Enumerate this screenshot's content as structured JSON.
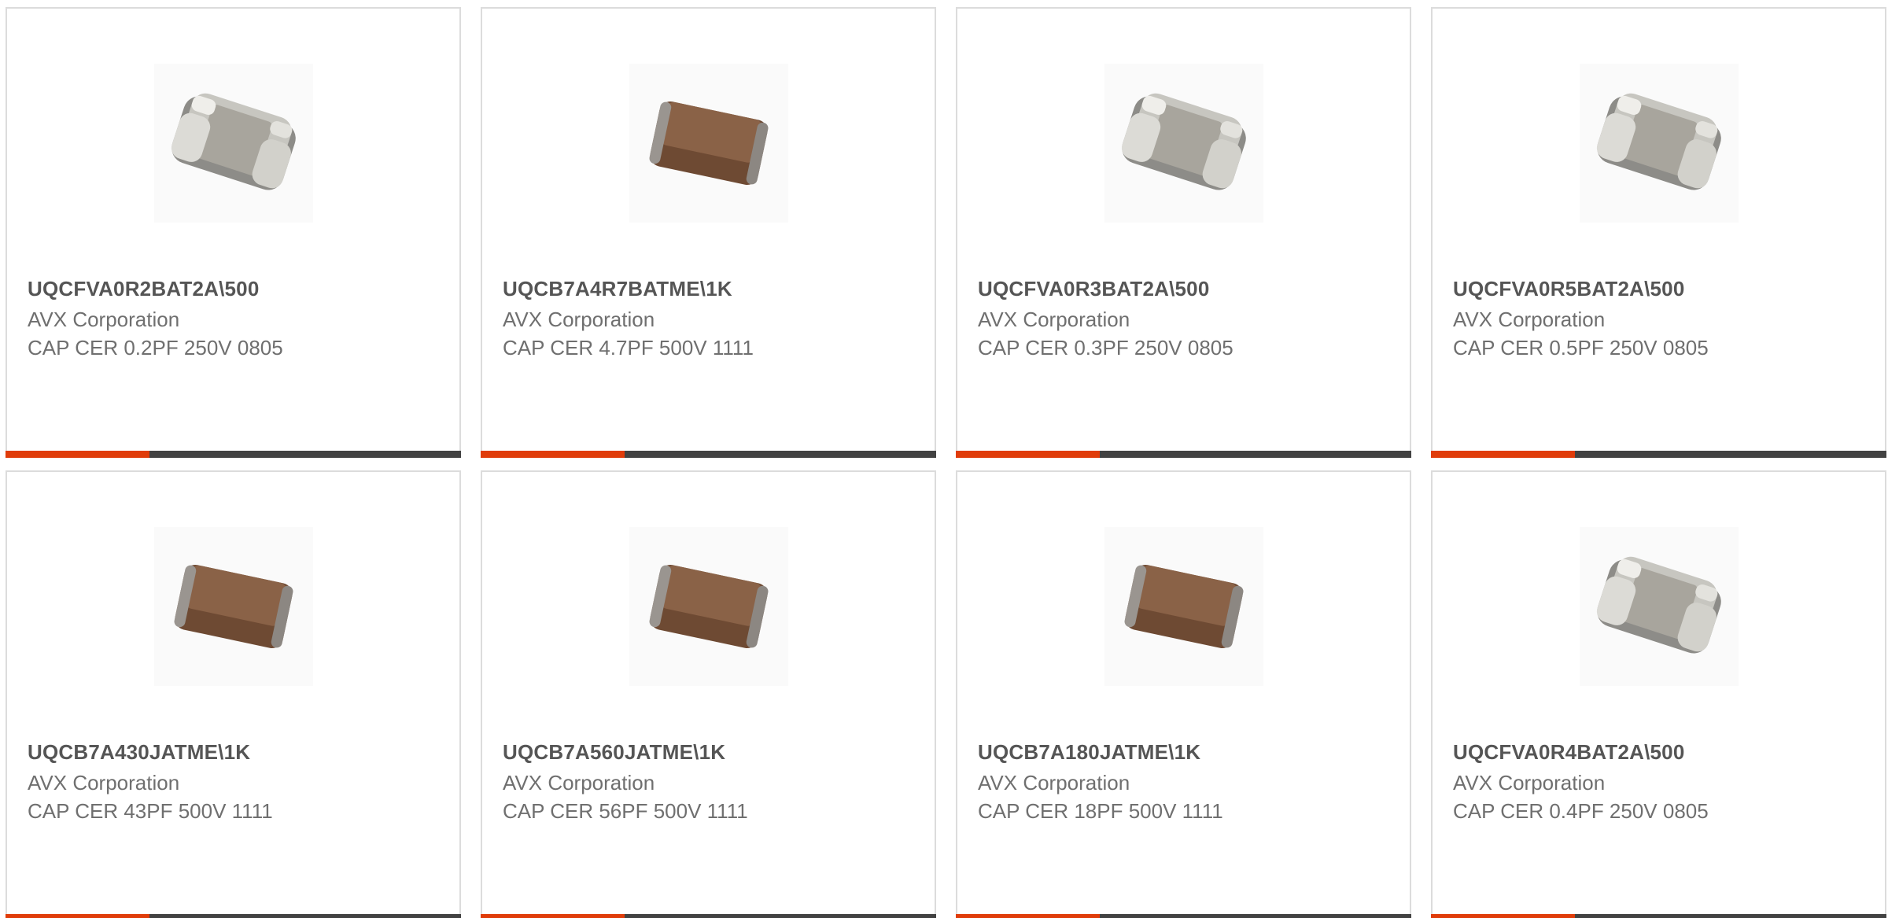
{
  "theme": {
    "accent": "#e03c0a",
    "bar": "#424242",
    "border": "#dcdcdc",
    "title_color": "#555555",
    "text_color": "#6f6f6f"
  },
  "products": [
    {
      "part_number": "UQCFVA0R2BAT2A\\500",
      "manufacturer": "AVX Corporation",
      "description": "CAP CER 0.2PF 250V 0805",
      "image_icon": "silver-capacitor-icon"
    },
    {
      "part_number": "UQCB7A4R7BATME\\1K",
      "manufacturer": "AVX Corporation",
      "description": "CAP CER 4.7PF 500V 1111",
      "image_icon": "brown-capacitor-icon"
    },
    {
      "part_number": "UQCFVA0R3BAT2A\\500",
      "manufacturer": "AVX Corporation",
      "description": "CAP CER 0.3PF 250V 0805",
      "image_icon": "silver-capacitor-icon"
    },
    {
      "part_number": "UQCFVA0R5BAT2A\\500",
      "manufacturer": "AVX Corporation",
      "description": "CAP CER 0.5PF 250V 0805",
      "image_icon": "silver-capacitor-icon"
    },
    {
      "part_number": "UQCB7A430JATME\\1K",
      "manufacturer": "AVX Corporation",
      "description": "CAP CER 43PF 500V 1111",
      "image_icon": "brown-capacitor-icon"
    },
    {
      "part_number": "UQCB7A560JATME\\1K",
      "manufacturer": "AVX Corporation",
      "description": "CAP CER 56PF 500V 1111",
      "image_icon": "brown-capacitor-icon"
    },
    {
      "part_number": "UQCB7A180JATME\\1K",
      "manufacturer": "AVX Corporation",
      "description": "CAP CER 18PF 500V 1111",
      "image_icon": "brown-capacitor-icon"
    },
    {
      "part_number": "UQCFVA0R4BAT2A\\500",
      "manufacturer": "AVX Corporation",
      "description": "CAP CER 0.4PF 250V 0805",
      "image_icon": "silver-capacitor-icon"
    }
  ]
}
